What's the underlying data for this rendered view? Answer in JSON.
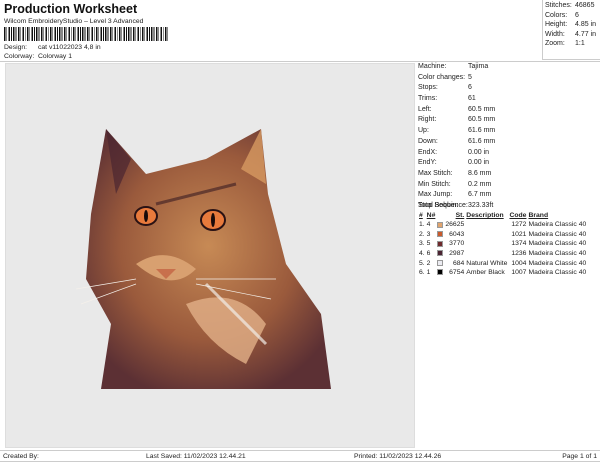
{
  "header": {
    "title": "Production Worksheet",
    "subtitle": "Wilcom EmbroideryStudio – Level 3 Advanced",
    "design_label": "Design:",
    "design_value": "cat v11022023 4,8 in",
    "colorway_label": "Colorway:",
    "colorway_value": "Colorway 1"
  },
  "stats": [
    {
      "label": "Stitches:",
      "value": "46865"
    },
    {
      "label": "Colors:",
      "value": "6"
    },
    {
      "label": "Height:",
      "value": "4.85 in"
    },
    {
      "label": "Width:",
      "value": "4.77 in"
    },
    {
      "label": "Zoom:",
      "value": "1:1"
    }
  ],
  "machine": [
    {
      "label": "Machine:",
      "value": "Tajima"
    },
    {
      "label": "Color changes:",
      "value": "5"
    },
    {
      "label": "Stops:",
      "value": "6"
    },
    {
      "label": "Trims:",
      "value": "61"
    },
    {
      "label": "Left:",
      "value": "60.5 mm"
    },
    {
      "label": "Right:",
      "value": "60.5 mm"
    },
    {
      "label": "Up:",
      "value": "61.6 mm"
    },
    {
      "label": "Down:",
      "value": "61.6 mm"
    },
    {
      "label": "EndX:",
      "value": "0.00 in"
    },
    {
      "label": "EndY:",
      "value": "0.00 in"
    },
    {
      "label": "Max Stitch:",
      "value": "8.6 mm"
    },
    {
      "label": "Min Stitch:",
      "value": "0.2 mm"
    },
    {
      "label": "Max Jump:",
      "value": "6.7 mm"
    },
    {
      "label": "Total Bobbin:",
      "value": "323.33ft"
    }
  ],
  "stop_sequence": {
    "title": "Stop Sequence:",
    "headers": [
      "#",
      "N#",
      "St.",
      "Description",
      "Code",
      "Brand"
    ],
    "rows": [
      {
        "n": "1.",
        "needle": "4",
        "color": "#e0a46e",
        "st": "26625",
        "desc": "",
        "code": "1272",
        "brand": "Madeira Classic 40"
      },
      {
        "n": "2.",
        "needle": "3",
        "color": "#c85a2c",
        "st": "6043",
        "desc": "",
        "code": "1021",
        "brand": "Madeira Classic 40"
      },
      {
        "n": "3.",
        "needle": "5",
        "color": "#6e2a2c",
        "st": "3770",
        "desc": "",
        "code": "1374",
        "brand": "Madeira Classic 40"
      },
      {
        "n": "4.",
        "needle": "6",
        "color": "#4a2432",
        "st": "2987",
        "desc": "",
        "code": "1236",
        "brand": "Madeira Classic 40"
      },
      {
        "n": "5.",
        "needle": "2",
        "color": "#ececf2",
        "st": "684",
        "desc": "Natural White",
        "code": "1004",
        "brand": "Madeira Classic 40"
      },
      {
        "n": "6.",
        "needle": "1",
        "color": "#000000",
        "st": "6754",
        "desc": "Amber Black",
        "code": "1007",
        "brand": "Madeira Classic 40"
      }
    ]
  },
  "footer": {
    "created_by": "Created By:",
    "last_saved": "Last Saved: 11/02/2023 12.44.21",
    "printed": "Printed: 11/02/2023 12.44.26",
    "page": "Page 1 of 1"
  }
}
